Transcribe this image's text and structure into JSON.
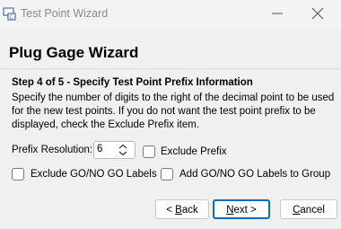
{
  "window": {
    "title": "Test Point Wizard",
    "icon": "app-icon",
    "accent_color": "#0f6cbd"
  },
  "wizard": {
    "heading": "Plug Gage Wizard",
    "step_title": "Step 4 of 5 - Specify Test Point Prefix Information",
    "description_lines": [
      "Specify the number of digits to the right of the decimal point to be used",
      "for the new test points.  If you do not want the test point prefix to be",
      "displayed, check the Exclude Prefix item."
    ]
  },
  "form": {
    "prefix_resolution_label": "Prefix Resolution:",
    "prefix_resolution_value": "6",
    "exclude_prefix_label": "Exclude Prefix",
    "exclude_prefix_checked": false,
    "exclude_go_nogo_label": "Exclude GO/NO GO Labels",
    "exclude_go_nogo_checked": false,
    "add_go_nogo_label": "Add GO/NO GO Labels to Group",
    "add_go_nogo_checked": false
  },
  "buttons": {
    "back": {
      "prefix": "< ",
      "mnemonic": "B",
      "rest": "ack"
    },
    "next": {
      "mnemonic": "N",
      "rest": "ext >"
    },
    "cancel": {
      "mnemonic": "C",
      "rest": "ancel"
    }
  }
}
